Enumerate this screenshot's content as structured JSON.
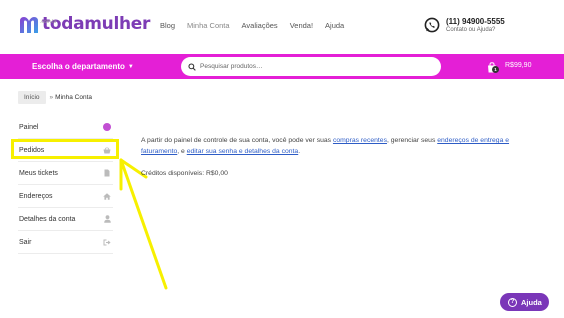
{
  "brand": {
    "name": "todamulher",
    "sub": ".com.br"
  },
  "top_nav": [
    "Blog",
    "Minha Conta",
    "Avaliações",
    "Venda!",
    "Ajuda"
  ],
  "contact": {
    "phone": "(11) 94900-5555",
    "help": "Contato ou Ajuda?"
  },
  "bar": {
    "department_label": "Escolha o departamento",
    "search_placeholder": "Pesquisar produtos…",
    "cart_count": "1",
    "cart_total": "R$99,90",
    "color": "#e41fd6"
  },
  "breadcrumb": {
    "home": "Início",
    "current": "Minha Conta"
  },
  "sidebar": {
    "items": [
      {
        "label": "Painel",
        "icon": "dashboard-icon"
      },
      {
        "label": "Pedidos",
        "icon": "basket-icon"
      },
      {
        "label": "Meus tickets",
        "icon": "ticket-icon"
      },
      {
        "label": "Endereços",
        "icon": "home-icon"
      },
      {
        "label": "Detalhes da conta",
        "icon": "user-icon"
      },
      {
        "label": "Sair",
        "icon": "logout-icon"
      }
    ]
  },
  "content": {
    "intro_1": "A partir do painel de controle de sua conta, você pode ver suas ",
    "link_orders": "compras recentes",
    "intro_2": ", gerenciar seus ",
    "link_addresses": "endereços de entrega e faturamento",
    "intro_3": ", e ",
    "link_account": "editar sua senha e detalhes da conta",
    "intro_4": ".",
    "credits": "Créditos disponíveis: R$0,00"
  },
  "help_button": {
    "label": "Ajuda"
  },
  "annotation": {
    "color": "#f7f000"
  }
}
